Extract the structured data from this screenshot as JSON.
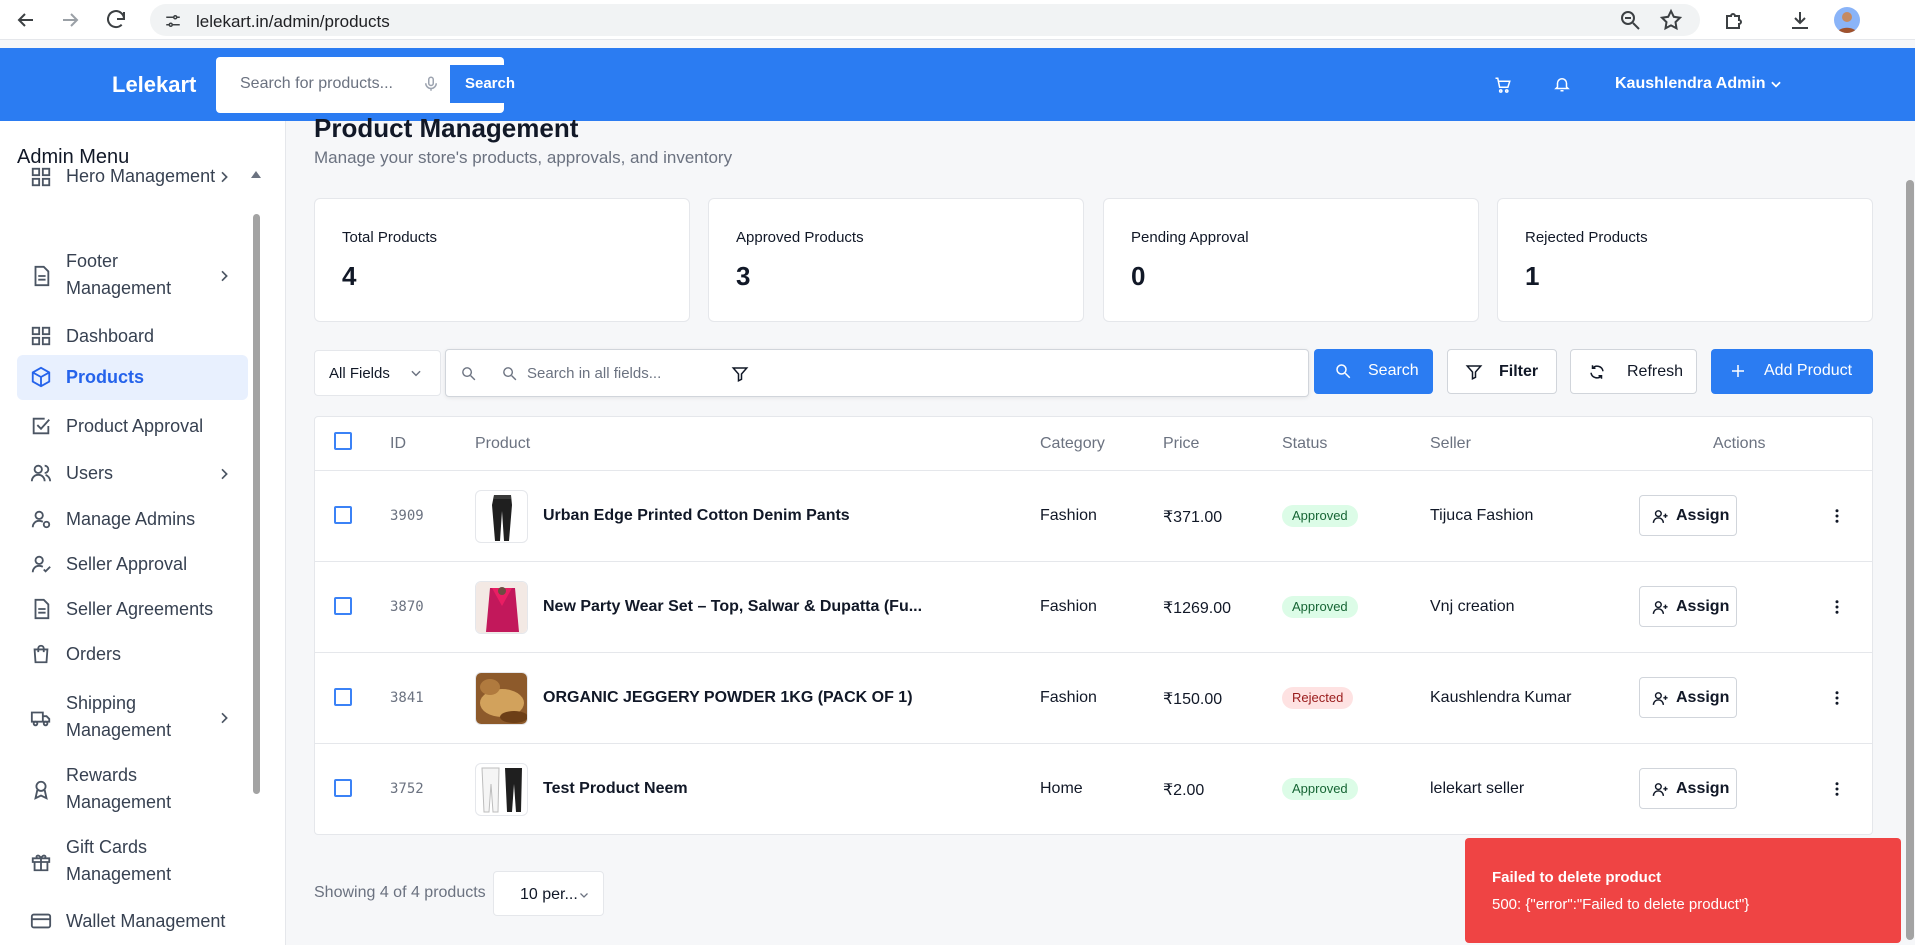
{
  "browser": {
    "url": "lelekart.in/admin/products"
  },
  "header": {
    "brand": "Lelekart",
    "search_placeholder": "Search for products...",
    "search_button": "Search",
    "user_name": "Kaushlendra Admin"
  },
  "sidebar": {
    "title": "Admin Menu",
    "items": [
      {
        "label": "Hero Management",
        "icon": "grid-icon",
        "has_submenu": true
      },
      {
        "label": "Footer Management",
        "icon": "document-icon",
        "has_submenu": true
      },
      {
        "label": "Dashboard",
        "icon": "grid-icon",
        "has_submenu": false
      },
      {
        "label": "Products",
        "icon": "cube-icon",
        "has_submenu": false,
        "active": true
      },
      {
        "label": "Product Approval",
        "icon": "check-square-icon",
        "has_submenu": false
      },
      {
        "label": "Users",
        "icon": "users-icon",
        "has_submenu": true
      },
      {
        "label": "Manage Admins",
        "icon": "user-cog-icon",
        "has_submenu": false
      },
      {
        "label": "Seller Approval",
        "icon": "user-check-icon",
        "has_submenu": false
      },
      {
        "label": "Seller Agreements",
        "icon": "document-icon",
        "has_submenu": false
      },
      {
        "label": "Orders",
        "icon": "shopping-bag-icon",
        "has_submenu": false
      },
      {
        "label": "Shipping Management",
        "icon": "truck-icon",
        "has_submenu": true
      },
      {
        "label": "Rewards Management",
        "icon": "award-icon",
        "has_submenu": false
      },
      {
        "label": "Gift Cards Management",
        "icon": "gift-icon",
        "has_submenu": false
      },
      {
        "label": "Wallet Management",
        "icon": "wallet-icon",
        "has_submenu": false
      }
    ]
  },
  "page": {
    "title": "Product Management",
    "subtitle": "Manage your store's products, approvals, and inventory"
  },
  "stats": [
    {
      "label": "Total Products",
      "value": "4"
    },
    {
      "label": "Approved Products",
      "value": "3"
    },
    {
      "label": "Pending Approval",
      "value": "0"
    },
    {
      "label": "Rejected Products",
      "value": "1"
    }
  ],
  "toolbar": {
    "field_select": "All Fields",
    "search_placeholder": "Search in all fields...",
    "search_button": "Search",
    "filter_button": "Filter",
    "refresh_button": "Refresh",
    "add_button": "Add Product"
  },
  "table": {
    "columns": [
      "ID",
      "Product",
      "Category",
      "Price",
      "Status",
      "Seller",
      "Actions"
    ],
    "rows": [
      {
        "id": "3909",
        "product": "Urban Edge Printed Cotton Denim Pants",
        "category": "Fashion",
        "price": "₹371.00",
        "status": "Approved",
        "seller": "Tijuca Fashion",
        "action": "Assign"
      },
      {
        "id": "3870",
        "product": "New Party Wear Set – Top, Salwar & Dupatta (Fu...",
        "category": "Fashion",
        "price": "₹1269.00",
        "status": "Approved",
        "seller": "Vnj creation",
        "action": "Assign"
      },
      {
        "id": "3841",
        "product": "ORGANIC JEGGERY POWDER 1KG (PACK OF 1)",
        "category": "Fashion",
        "price": "₹150.00",
        "status": "Rejected",
        "seller": "Kaushlendra Kumar",
        "action": "Assign"
      },
      {
        "id": "3752",
        "product": "Test Product Neem",
        "category": "Home",
        "price": "₹2.00",
        "status": "Approved",
        "seller": "lelekart seller",
        "action": "Assign"
      }
    ]
  },
  "pagination": {
    "info": "Showing 4 of 4 products",
    "per_page": "10 per..."
  },
  "toast": {
    "title": "Failed to delete product",
    "message": "500: {\"error\":\"Failed to delete product\"}",
    "color": "#ef4444"
  },
  "colors": {
    "primary": "#2b7cf2",
    "approved": "#dcfce7",
    "rejected": "#fee2e2"
  }
}
